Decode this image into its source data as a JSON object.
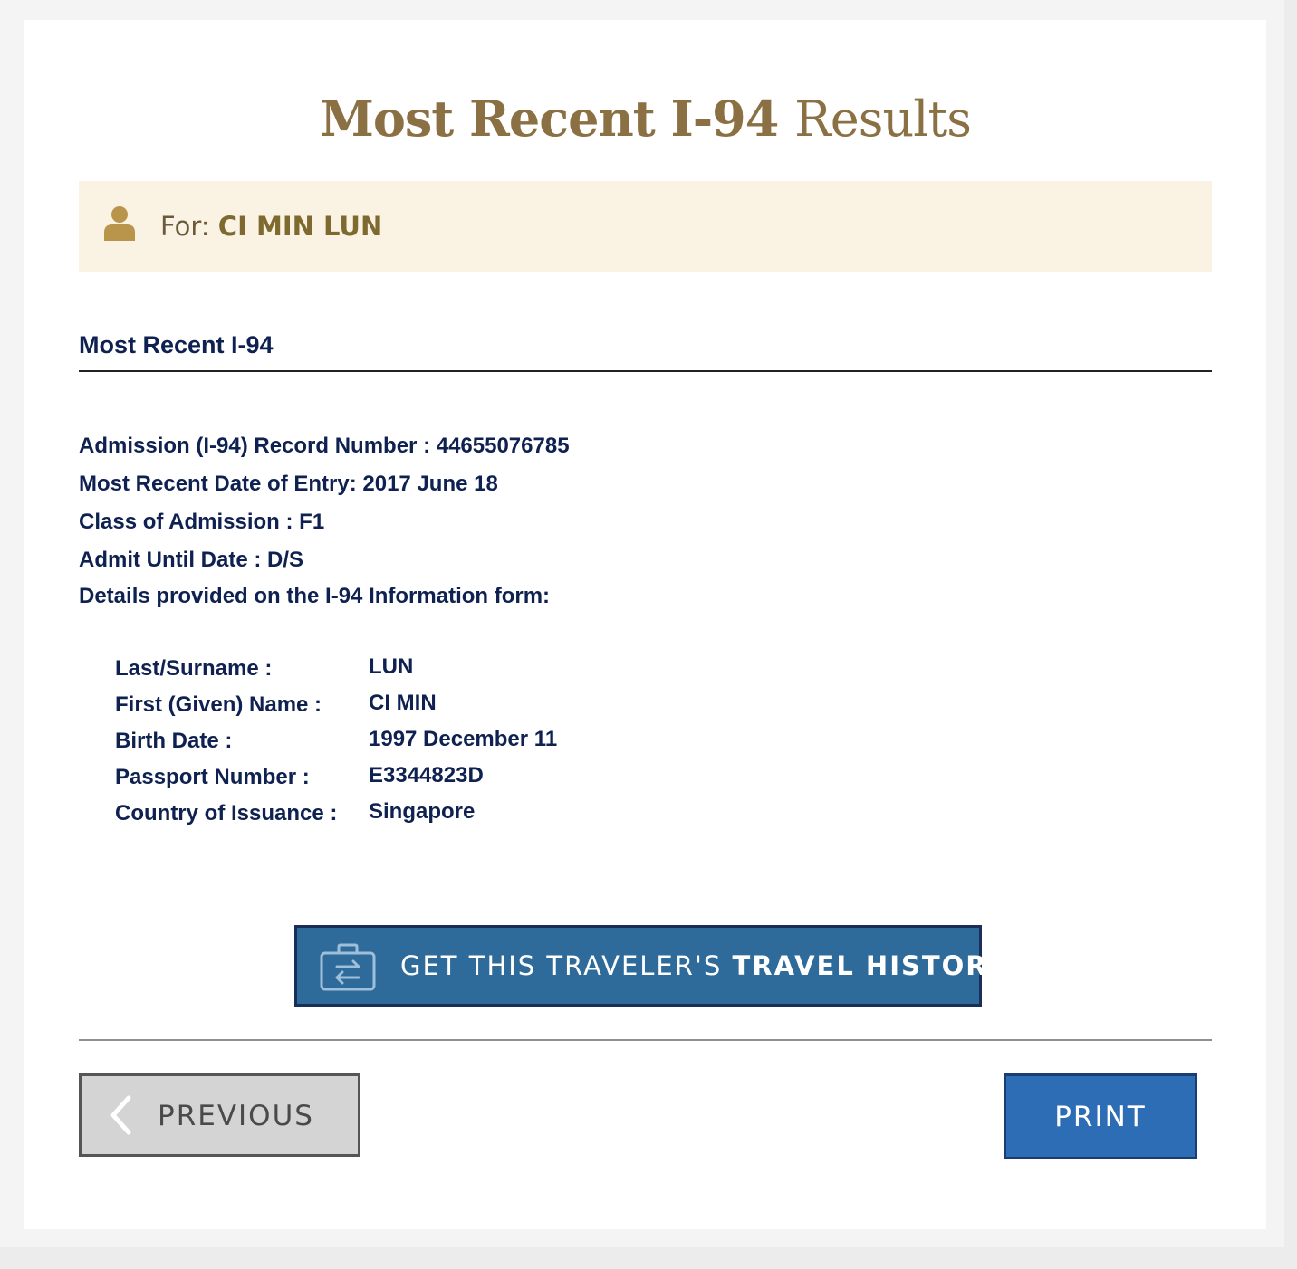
{
  "header": {
    "title_bold": "Most Recent I-94",
    "title_light": "Results"
  },
  "for_bar": {
    "prefix": "For:",
    "name": "CI MIN LUN",
    "icon": "person-icon"
  },
  "record": {
    "section_title": "Most Recent I-94",
    "lines": [
      "Admission (I-94) Record Number : 44655076785",
      "Most Recent Date of Entry: 2017 June 18",
      "Class of Admission : F1",
      "Admit Until Date : D/S",
      "Details provided on the I-94 Information form:"
    ],
    "details": [
      {
        "label": "Last/Surname :",
        "value": "LUN"
      },
      {
        "label": "First (Given) Name :",
        "value": "CI MIN"
      },
      {
        "label": "Birth Date :",
        "value": "1997 December 11"
      },
      {
        "label": "Passport Number :",
        "value": "E3344823D"
      },
      {
        "label": "Country of Issuance :",
        "value": "Singapore"
      }
    ]
  },
  "actions": {
    "travel_history_prefix": "GET THIS TRAVELER'S",
    "travel_history_strong": "TRAVEL HISTORY",
    "travel_icon": "briefcase-transfer-icon",
    "previous_label": "PREVIOUS",
    "print_label": "PRINT"
  },
  "colors": {
    "title": "#8a7043",
    "for_bar_bg": "#faf2e3",
    "text_navy": "#0e2150",
    "travel_btn": "#2e6a9a",
    "print_btn": "#2d6db5",
    "previous_btn": "#d4d4d4"
  }
}
